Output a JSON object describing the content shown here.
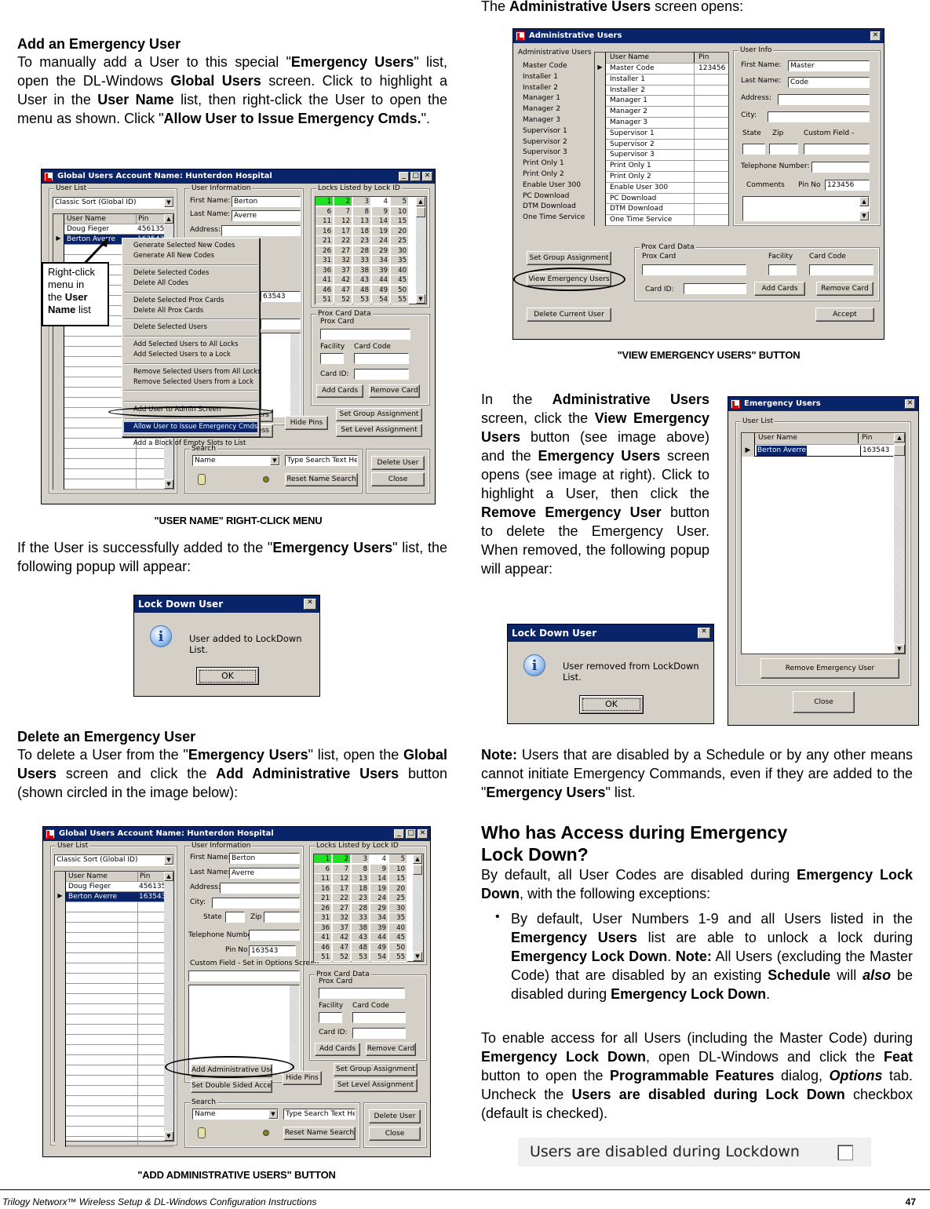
{
  "left_column": {
    "add_heading": "Add an Emergency User",
    "add_paragraph": [
      {
        "t": "To manually add a User to this special \""
      },
      {
        "b": "Emergency Users"
      },
      {
        "t": "\" list, open the DL-Windows "
      },
      {
        "b": "Global Users"
      },
      {
        "t": " screen. Click to highlight a User in the "
      },
      {
        "b": "User Name"
      },
      {
        "t": " list, then right-click the User to open the menu as shown.  Click \""
      },
      {
        "b": "Allow User to Issue Emergency Cmds."
      },
      {
        "t": "\"."
      }
    ],
    "caption1": "\"USER NAME\" RIGHT-CLICK MENU",
    "success_paragraph": [
      {
        "t": "If the User is successfully added to the \""
      },
      {
        "b": "Emergency Users"
      },
      {
        "t": "\" list, the following popup will appear:"
      }
    ],
    "delete_heading": "Delete an Emergency User",
    "delete_paragraph": [
      {
        "t": "To delete a User from the \""
      },
      {
        "b": "Emergency Users"
      },
      {
        "t": "\" list, open the "
      },
      {
        "b": "Global Users"
      },
      {
        "t": " screen and click the "
      },
      {
        "b": "Add Administrative Users"
      },
      {
        "t": " button (shown circled in the image below):"
      }
    ],
    "caption2": "\"ADD ADMINISTRATIVE USERS\" BUTTON"
  },
  "right_column": {
    "intro": [
      {
        "t": "The "
      },
      {
        "b": "Administrative Users"
      },
      {
        "t": " screen opens:"
      }
    ],
    "caption": "\"VIEW EMERGENCY USERS\" BUTTON",
    "remove_paragraph": [
      {
        "t": "In the "
      },
      {
        "b": "Administrative Users"
      },
      {
        "t": " screen, click the "
      },
      {
        "b": "View Emergency Users"
      },
      {
        "t": " button (see image above) and the "
      },
      {
        "b": "Emergency Users"
      },
      {
        "t": " screen opens (see image at right).  Click to highlight a User, then click the "
      },
      {
        "b": "Remove Emergency User"
      },
      {
        "t": " button to delete the Emergency User.  When removed, the following popup will appear:"
      }
    ],
    "note_paragraph": [
      {
        "b": "Note:"
      },
      {
        "t": "  Users that are disabled by a Schedule or by any other means cannot initiate Emergency Commands, even if they are added to the \""
      },
      {
        "b": "Emergency Users"
      },
      {
        "t": "\" list."
      }
    ],
    "access_heading_line1": "Who has Access during Emergency",
    "access_heading_line2": "Lock Down?",
    "access_paragraph": [
      {
        "t": "By default, all User Codes are disabled during "
      },
      {
        "b": "Emergency Lock Down"
      },
      {
        "t": ", with the following exceptions:"
      }
    ],
    "bullet": [
      {
        "t": "By default, User Numbers 1-9 and all Users listed in the "
      },
      {
        "b": "Emergency Users"
      },
      {
        "t": " list are able to unlock a lock during "
      },
      {
        "b": "Emergency Lock Down"
      },
      {
        "t": ".  "
      },
      {
        "b": "Note:"
      },
      {
        "t": "  All Users (excluding the Master Code) that are disabled by an existing "
      },
      {
        "b": "Schedule"
      },
      {
        "t": " will "
      },
      {
        "bi": "also"
      },
      {
        "t": " be disabled during "
      },
      {
        "b": "Emergency Lock Down"
      },
      {
        "t": "."
      }
    ],
    "enable_paragraph": [
      {
        "t": "To enable access for all Users (including the Master Code) during "
      },
      {
        "b": "Emergency Lock Down"
      },
      {
        "t": ", open DL-Windows and click the "
      },
      {
        "b": "Feat"
      },
      {
        "t": " button to open the "
      },
      {
        "b": "Programmable Features"
      },
      {
        "t": " dialog, "
      },
      {
        "bi": "Options"
      },
      {
        "t": " tab.  Uncheck the "
      },
      {
        "b": "Users are disabled during Lock Down"
      },
      {
        "t": " checkbox (default is checked)."
      }
    ],
    "checkbox_label": "Users are disabled during Lockdown",
    "checkbox_checked": false
  },
  "global_users": {
    "title": "Global Users Account Name: Hunterdon Hospital",
    "user_list_label": "User List",
    "sort_value": "Classic Sort (Global ID)",
    "col_user": "User Name",
    "col_pin": "Pin",
    "users": [
      {
        "name": "Doug Fieger",
        "pin": "456135"
      },
      {
        "name": "Berton Averre",
        "pin": "163543"
      }
    ],
    "user_info_label": "User Information",
    "first_name_label": "First Name:",
    "first_name": "Berton",
    "last_name_label": "Last Name:",
    "last_name": "Averre",
    "address_label": "Address:",
    "city_label": "City:",
    "state_label": "State",
    "zip_label": "Zip",
    "phone_label": "Telephone Number:",
    "pin_label": "Pin No",
    "pin": "163543",
    "custom_label": "Custom Field - Set in Options Screen",
    "locks_label": "Locks Listed by Lock ID",
    "locks_green": [
      1,
      2
    ],
    "locks_white": [
      4
    ],
    "prox_label": "Prox Card Data",
    "prox_card_label": "Prox Card",
    "facility_label": "Facility",
    "card_code_label": "Card Code",
    "card_id_label": "Card ID:",
    "add_cards": "Add Cards",
    "remove_card": "Remove Card",
    "add_admin": "Add Administrative Users",
    "double_sided": "Set Double Sided Access",
    "hide_pins": "Hide Pins",
    "set_group": "Set Group Assignment",
    "set_level": "Set Level Assignment",
    "search_label": "Search",
    "search_field": "Name",
    "search_placeholder": "Type Search Text Here",
    "reset_search": "Reset Name Search",
    "delete_user": "Delete User",
    "close": "Close",
    "context_menu": [
      [
        "Generate Selected New Codes",
        "Generate All New Codes"
      ],
      [
        "Delete Selected Codes",
        "Delete All Codes"
      ],
      [
        "Delete Selected Prox Cards",
        "Delete All Prox Cards"
      ],
      [
        "Delete Selected Users"
      ],
      [
        "Add Selected Users to All Locks",
        "Add Selected Users to a Lock"
      ],
      [
        "Remove Selected Users from All Locks",
        "Remove Selected Users from a Lock"
      ],
      [],
      [
        "Add User to Admin Screen"
      ],
      [
        "Allow User to Issue Emergency Cmds."
      ],
      [
        "Add a Block of Empty Slots to List"
      ]
    ],
    "callout": [
      "Right-click",
      "menu in",
      "the ",
      "User",
      "Name",
      " list"
    ]
  },
  "admin_users": {
    "title": "Administrative Users",
    "list_label": "Administrative Users",
    "labels": [
      "Master Code",
      "Installer 1",
      "Installer 2",
      "Manager 1",
      "Manager 2",
      "Manager 3",
      "Supervisor 1",
      "Supervisor 2",
      "Supervisor 3",
      "Print Only 1",
      "Print Only 2",
      "Enable User 300",
      "PC Download",
      "DTM Download",
      "One Time Service"
    ],
    "col_user": "User Name",
    "col_pin": "Pin",
    "master_pin": "123456",
    "user_info_label": "User Info",
    "first_name_label": "First Name:",
    "first_name": "Master",
    "last_name_label": "Last Name:",
    "last_name": "Code",
    "address_label": "Address:",
    "city_label": "City:",
    "state_label": "State",
    "zip_label": "Zip",
    "custom_label": "Custom Field -",
    "phone_label": "Telephone Number:",
    "comments_label": "Comments",
    "pin_label": "Pin No",
    "pin": "123456",
    "set_group": "Set Group Assignment",
    "view_emergency": "View Emergency Users",
    "delete_current": "Delete Current User",
    "prox_label": "Prox Card Data",
    "prox_card_label": "Prox Card",
    "facility_label": "Facility",
    "card_code_label": "Card Code",
    "card_id_label": "Card ID:",
    "add_cards": "Add Cards",
    "remove_card": "Remove Card",
    "accept": "Accept"
  },
  "emergency_users": {
    "title": "Emergency Users",
    "list_label": "User List",
    "col_user": "User Name",
    "col_pin": "Pin",
    "user": "Berton Averre",
    "pin": "163543",
    "remove": "Remove Emergency User",
    "close": "Close"
  },
  "popup_added": {
    "title": "Lock Down User",
    "message": "User added to LockDown List.",
    "ok": "OK"
  },
  "popup_removed": {
    "title": "Lock Down User",
    "message": "User removed from LockDown List.",
    "ok": "OK"
  },
  "footer": {
    "title": "Trilogy Networx™ Wireless Setup & DL-Windows Configuration Instructions",
    "page": "47"
  }
}
